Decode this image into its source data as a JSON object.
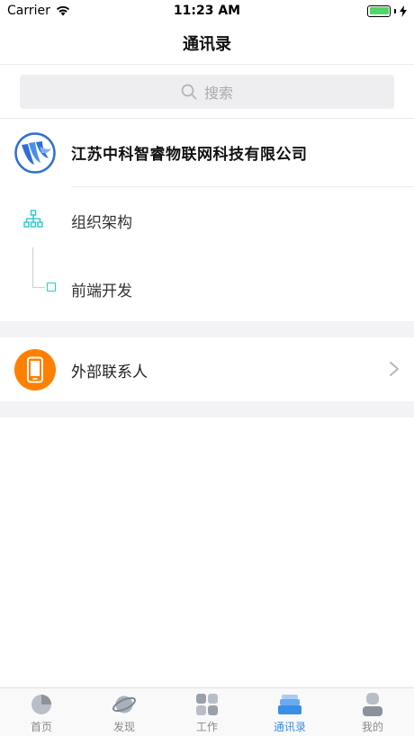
{
  "status_bar": {
    "carrier": "Carrier",
    "time": "11:23 AM"
  },
  "nav": {
    "title": "通讯录"
  },
  "search": {
    "placeholder": "搜索"
  },
  "company": {
    "name": "江苏中科智睿物联网科技有限公司"
  },
  "org": {
    "root_label": "组织架构",
    "child_label": "前端开发"
  },
  "external": {
    "label": "外部联系人"
  },
  "tabs": [
    {
      "label": "首页",
      "icon": "home-pie-icon"
    },
    {
      "label": "发现",
      "icon": "planet-icon"
    },
    {
      "label": "工作",
      "icon": "grid-icon"
    },
    {
      "label": "通讯录",
      "icon": "contacts-icon"
    },
    {
      "label": "我的",
      "icon": "profile-icon"
    }
  ],
  "colors": {
    "accent": "#3a8ee6",
    "org_icon": "#2ec7c9",
    "external_icon_bg": "#ff7f00",
    "battery": "#4cd964"
  }
}
